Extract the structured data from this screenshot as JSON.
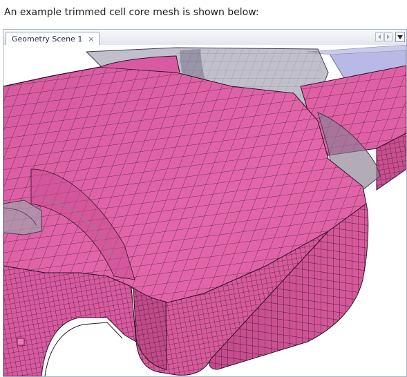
{
  "caption": "An example trimmed cell core mesh is shown below:",
  "window": {
    "tab_label": "Geometry Scene 1",
    "tab_close_glyph": "×",
    "nav_prev_icon": "chevron-left-icon",
    "nav_next_icon": "chevron-right-icon",
    "menu_icon": "dropdown-arrow-icon"
  },
  "scene": {
    "mesh_color": "#e060a6",
    "mesh_shadow_color": "#b33d7c",
    "mesh_line_color": "#2e1424",
    "transparent_shell_color": "#8c8aa0",
    "background_box_color": "#b8b9e6"
  }
}
